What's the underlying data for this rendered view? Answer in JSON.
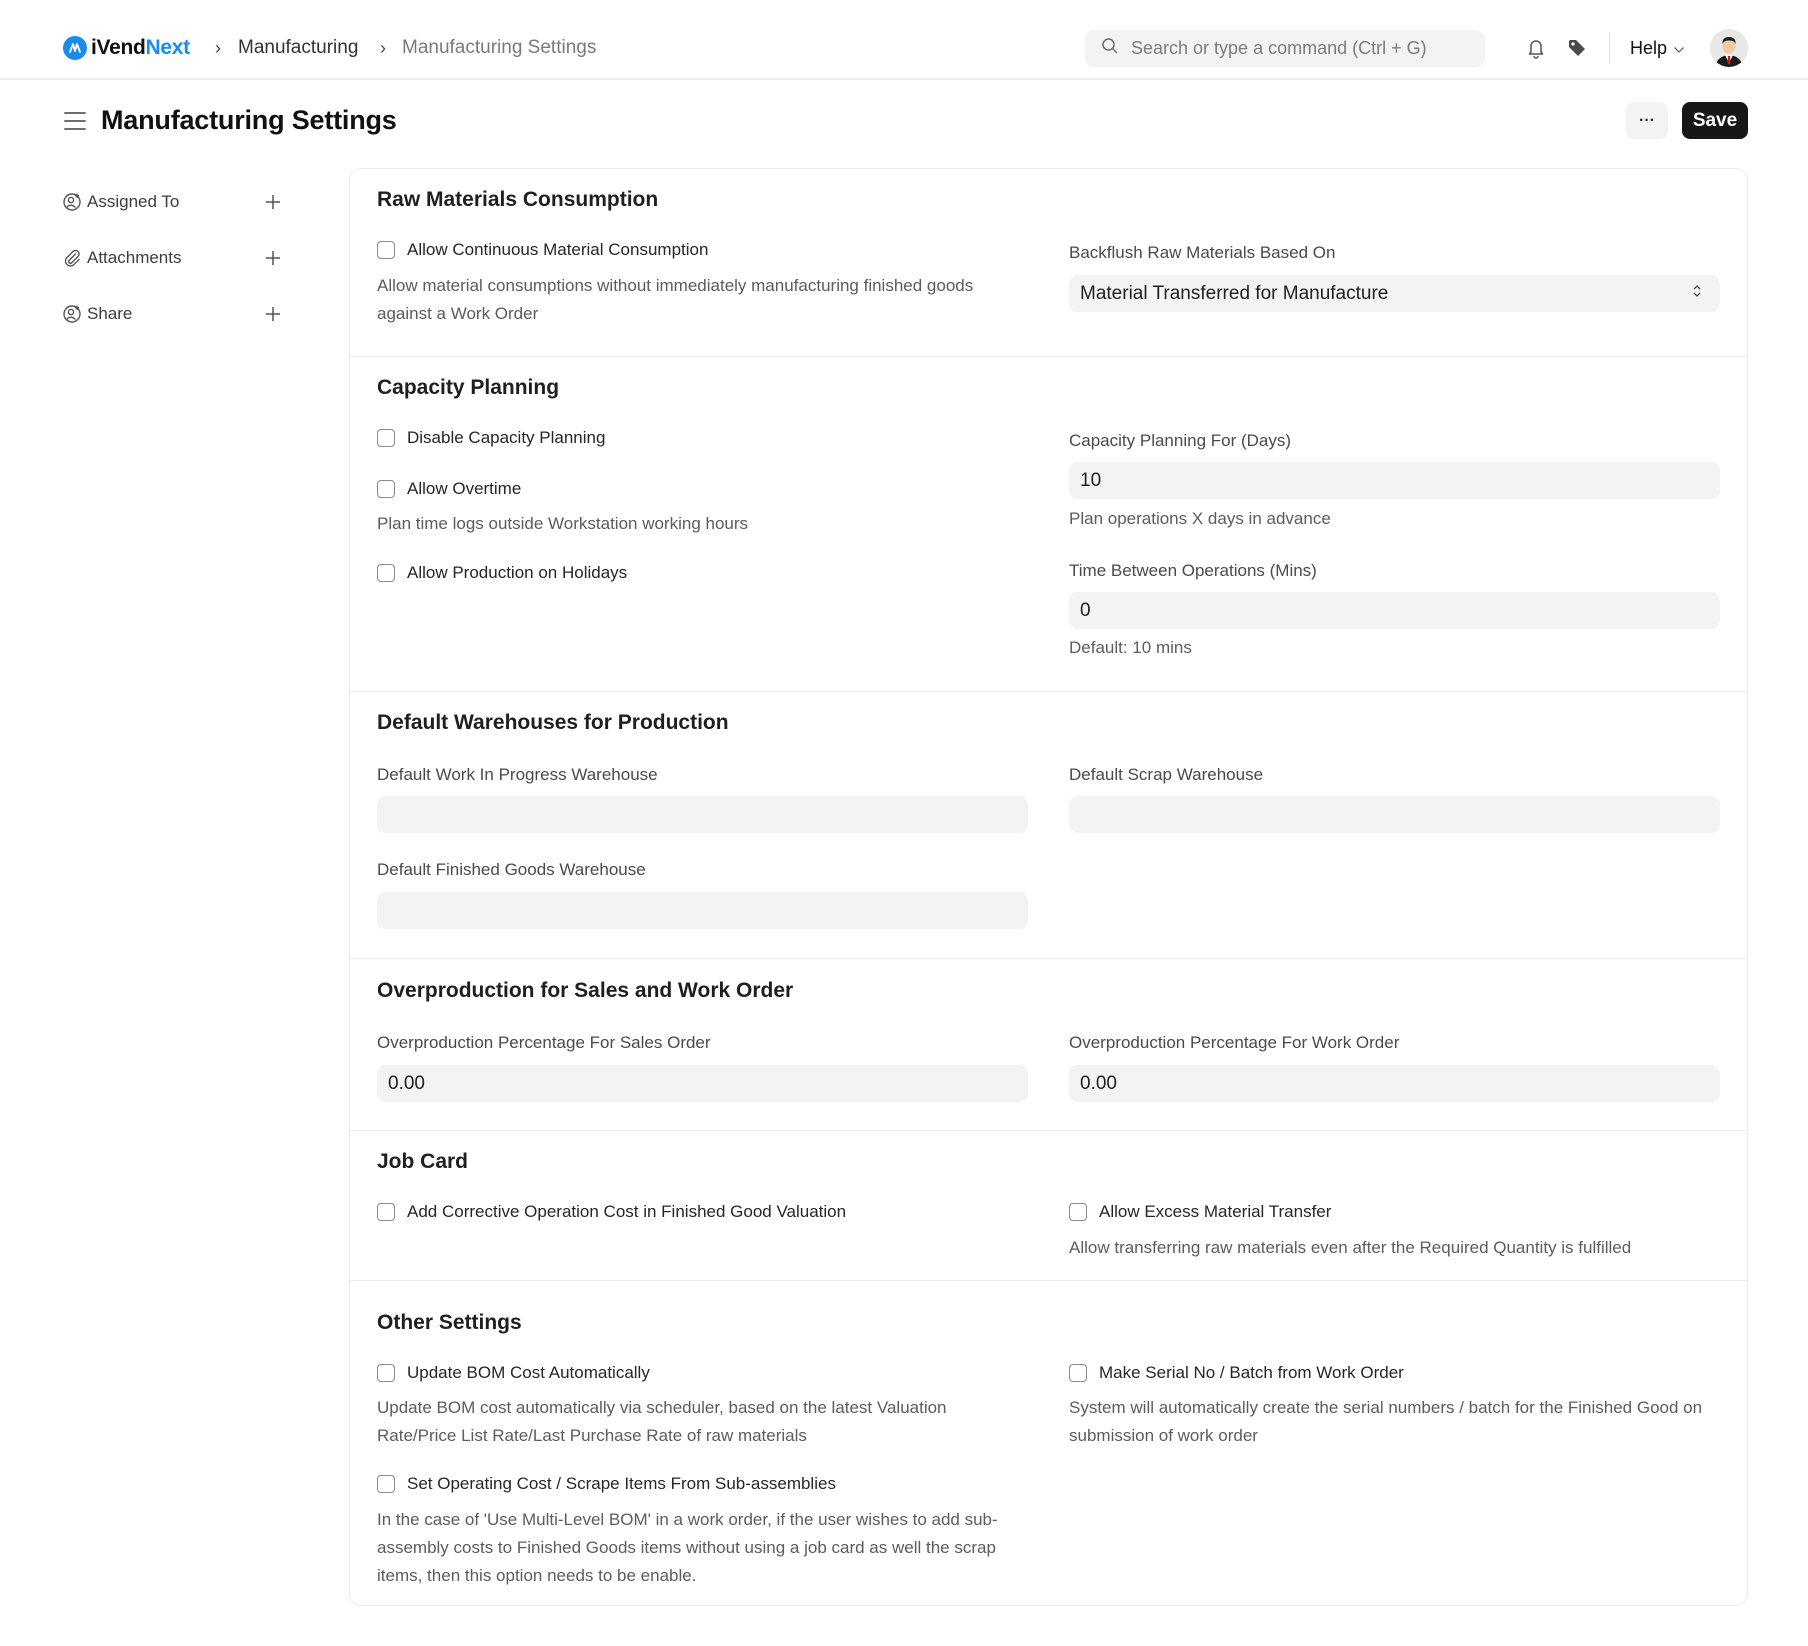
{
  "navbar": {
    "logo_prefix": "iVend",
    "logo_suffix": "Next",
    "breadcrumb": [
      "Manufacturing",
      "Manufacturing Settings"
    ],
    "breadcrumb_separator": "›",
    "search_placeholder": "Search or type a command (Ctrl + G)",
    "search_value": "",
    "help_label": "Help",
    "icons": {
      "logo": "ivendnext-logo-icon",
      "search": "search-icon",
      "notifications": "bell-icon",
      "tags": "tag-icon",
      "help_dropdown": "chevron-down-icon",
      "user": "avatar"
    },
    "accent_color": "#1a8cf0"
  },
  "page": {
    "title": "Manufacturing Settings",
    "more_label": "···",
    "save_label": "Save"
  },
  "sidebar": {
    "items": [
      {
        "label": "Assigned To",
        "icon": "user-plus-icon",
        "action": "+"
      },
      {
        "label": "Attachments",
        "icon": "paperclip-icon",
        "action": "+"
      },
      {
        "label": "Share",
        "icon": "user-plus-icon",
        "action": "+"
      }
    ]
  },
  "sections": {
    "raw_materials": {
      "title": "Raw Materials Consumption",
      "allow_continuous": {
        "label": "Allow Continuous Material Consumption",
        "checked": false
      },
      "allow_continuous_desc": "Allow material consumptions without immediately manufacturing finished goods against a Work Order",
      "backflush_label": "Backflush Raw Materials Based On",
      "backflush_value": "Material Transferred for Manufacture"
    },
    "capacity_planning": {
      "title": "Capacity Planning",
      "disable_capacity": {
        "label": "Disable Capacity Planning",
        "checked": false
      },
      "allow_overtime": {
        "label": "Allow Overtime",
        "checked": false
      },
      "allow_overtime_desc": "Plan time logs outside Workstation working hours",
      "allow_holidays": {
        "label": "Allow Production on Holidays",
        "checked": false
      },
      "planning_days_label": "Capacity Planning For (Days)",
      "planning_days_value": "10",
      "planning_days_desc": "Plan operations X days in advance",
      "time_between_label": "Time Between Operations (Mins)",
      "time_between_value": "0",
      "time_between_desc": "Default: 10 mins"
    },
    "warehouses": {
      "title": "Default Warehouses for Production",
      "wip_label": "Default Work In Progress Warehouse",
      "wip_value": "",
      "scrap_label": "Default Scrap Warehouse",
      "scrap_value": "",
      "fg_label": "Default Finished Goods Warehouse",
      "fg_value": ""
    },
    "overproduction": {
      "title": "Overproduction for Sales and Work Order",
      "sales_label": "Overproduction Percentage For Sales Order",
      "sales_value": "0.00",
      "work_label": "Overproduction Percentage For Work Order",
      "work_value": "0.00"
    },
    "job_card": {
      "title": "Job Card",
      "corrective_cost": {
        "label": "Add Corrective Operation Cost in Finished Good Valuation",
        "checked": false
      },
      "excess_transfer": {
        "label": "Allow Excess Material Transfer",
        "checked": false
      },
      "excess_transfer_desc": "Allow transferring raw materials even after the Required Quantity is fulfilled"
    },
    "other": {
      "title": "Other Settings",
      "update_bom": {
        "label": "Update BOM Cost Automatically",
        "checked": false
      },
      "update_bom_desc": "Update BOM cost automatically via scheduler, based on the latest Valuation Rate/Price List Rate/Last Purchase Rate of raw materials",
      "set_operating": {
        "label": "Set Operating Cost / Scrape Items From Sub-assemblies",
        "checked": false
      },
      "set_operating_desc": "In the case of 'Use Multi-Level BOM' in a work order, if the user wishes to add sub-assembly costs to Finished Goods items without using a job card as well the scrap items, then this option needs to be enable.",
      "make_serial": {
        "label": "Make Serial No / Batch from Work Order",
        "checked": false
      },
      "make_serial_desc": "System will automatically create the serial numbers / batch for the Finished Good on submission of work order"
    }
  }
}
